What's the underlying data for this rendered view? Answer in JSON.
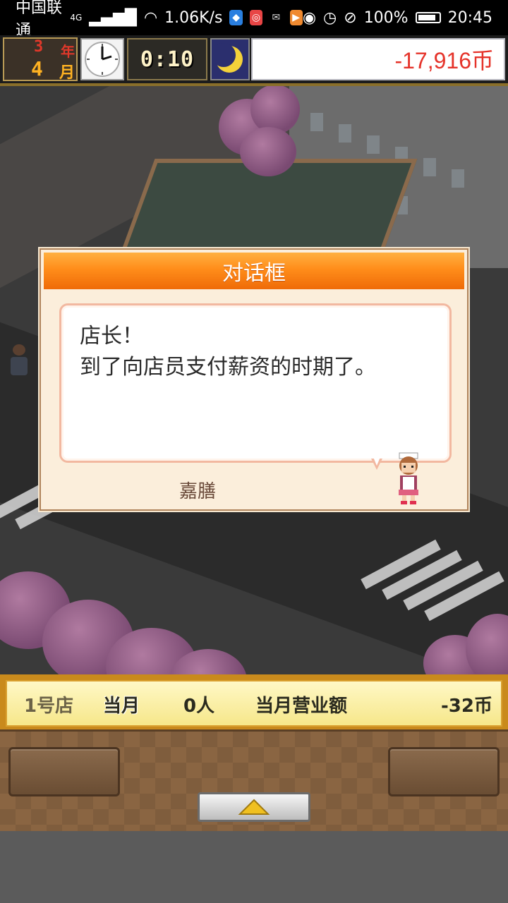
{
  "status_bar": {
    "carrier": "中国联通",
    "network": "4G",
    "speed": "1.06K/s",
    "battery": "100%",
    "time": "20:45"
  },
  "hud": {
    "year_num": "3",
    "year_label": "年",
    "month_num": "4",
    "month_label": "月",
    "game_time": "0:10",
    "money": "-17,916币"
  },
  "dialog": {
    "title": "对话框",
    "lines": [
      "店长！",
      "到了向店员支付薪资的时期了。"
    ],
    "speaker": "嘉膳"
  },
  "info_bar": {
    "store": "1号店",
    "current_month": "当月",
    "customers": "0人",
    "monthly_revenue_label": "当月营业额",
    "monthly_revenue_value": "-32币"
  },
  "colors": {
    "title_orange": "#ff8d1a",
    "money_red": "#e5332a",
    "panel_brown": "#8a6542",
    "info_yellow": "#f6e78a"
  },
  "icons": {
    "clock": "clock-icon",
    "moon": "moon-icon",
    "expand": "triangle-up-icon"
  }
}
